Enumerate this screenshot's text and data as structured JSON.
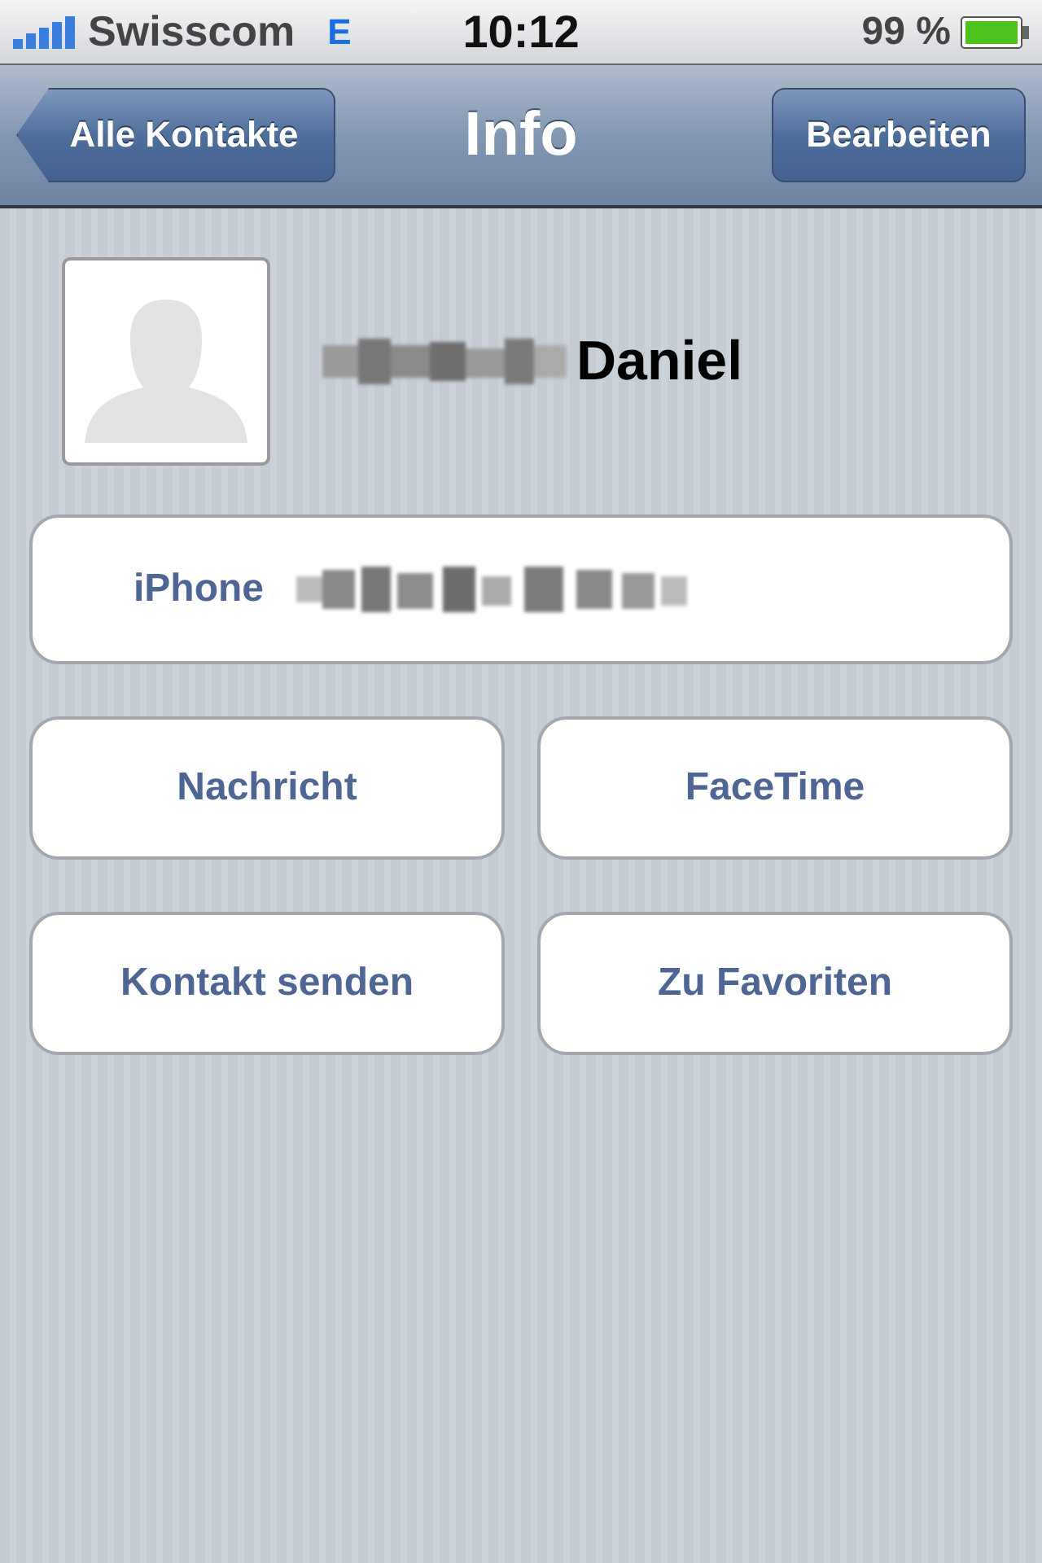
{
  "status_bar": {
    "carrier": "Swisscom",
    "network": "E",
    "time": "10:12",
    "battery": "99 %"
  },
  "nav_bar": {
    "back": "Alle Kontakte",
    "title": "Info",
    "action": "Bearbeiten"
  },
  "contact": {
    "name": "Daniel"
  },
  "phone": {
    "label": "iPhone"
  },
  "buttons": [
    {
      "label": "Nachricht"
    },
    {
      "label": "FaceTime"
    },
    {
      "label": "Kontakt senden"
    },
    {
      "label": "Zu Favoriten"
    }
  ]
}
